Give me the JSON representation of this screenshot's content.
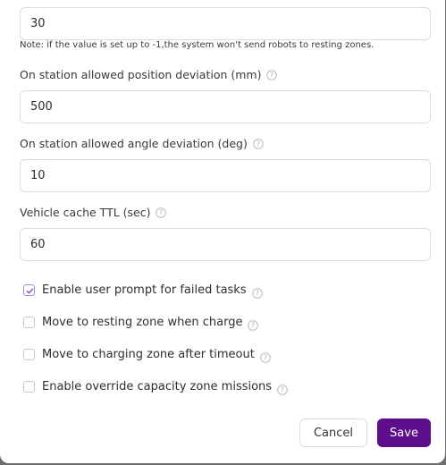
{
  "fields": {
    "resting_timeout": {
      "value": "30",
      "note": "Note: if the value is set up to -1,the system won't send robots to resting zones."
    },
    "position_deviation": {
      "label": "On station allowed position deviation (mm)",
      "value": "500"
    },
    "angle_deviation": {
      "label": "On station allowed angle deviation (deg)",
      "value": "10"
    },
    "vehicle_cache_ttl": {
      "label": "Vehicle cache TTL (sec)",
      "value": "60"
    }
  },
  "checkboxes": [
    {
      "label": "Enable user prompt for failed tasks",
      "checked": true
    },
    {
      "label": "Move to resting zone when charge",
      "checked": false
    },
    {
      "label": "Move to charging zone after timeout",
      "checked": false
    },
    {
      "label": "Enable override capacity zone missions",
      "checked": false
    }
  ],
  "buttons": {
    "cancel_label": "Cancel",
    "save_label": "Save"
  },
  "colors": {
    "accent": "#5c0e8b",
    "checkbox_check": "#7b4bb8"
  }
}
